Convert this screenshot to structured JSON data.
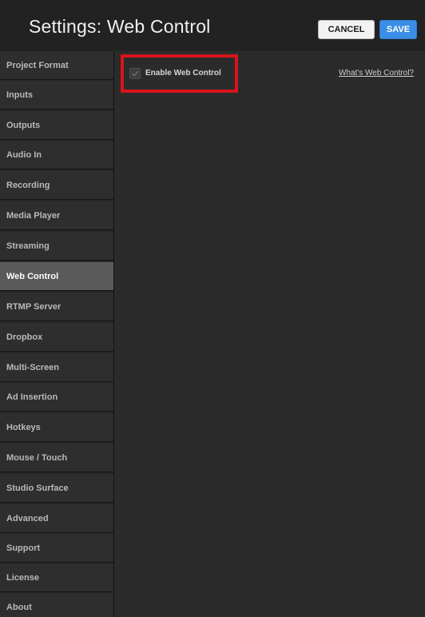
{
  "header": {
    "title": "Settings: Web Control",
    "cancel_label": "CANCEL",
    "save_label": "SAVE"
  },
  "sidebar": {
    "items": [
      {
        "label": "Project Format",
        "active": false
      },
      {
        "label": "Inputs",
        "active": false
      },
      {
        "label": "Outputs",
        "active": false
      },
      {
        "label": "Audio In",
        "active": false
      },
      {
        "label": "Recording",
        "active": false
      },
      {
        "label": "Media Player",
        "active": false
      },
      {
        "label": "Streaming",
        "active": false
      },
      {
        "label": "Web Control",
        "active": true
      },
      {
        "label": "RTMP Server",
        "active": false
      },
      {
        "label": "Dropbox",
        "active": false
      },
      {
        "label": "Multi-Screen",
        "active": false
      },
      {
        "label": "Ad Insertion",
        "active": false
      },
      {
        "label": "Hotkeys",
        "active": false
      },
      {
        "label": "Mouse / Touch",
        "active": false
      },
      {
        "label": "Studio Surface",
        "active": false
      },
      {
        "label": "Advanced",
        "active": false
      },
      {
        "label": "Support",
        "active": false
      },
      {
        "label": "License",
        "active": false
      },
      {
        "label": "About",
        "active": false
      }
    ]
  },
  "main": {
    "enable_label": "Enable Web Control",
    "enable_checked": true,
    "help_link": "What's Web Control?"
  },
  "colors": {
    "accent_save": "#3a8ee6",
    "highlight": "#d9141b",
    "active_item": "#5a5a5a"
  }
}
